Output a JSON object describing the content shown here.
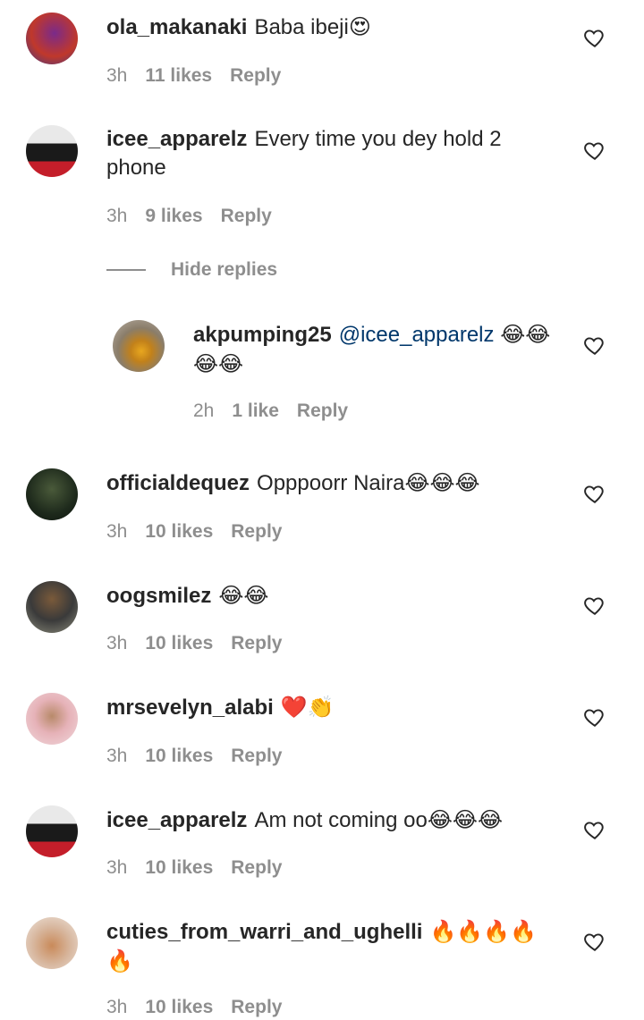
{
  "comments": [
    {
      "username": "ola_makanaki",
      "text": "Baba ibeji",
      "emoji": "😍",
      "time": "3h",
      "likes": "11 likes",
      "reply": "Reply"
    },
    {
      "username": "icee_apparelz",
      "text": "Every time you dey hold 2",
      "text2": "phone",
      "time": "3h",
      "likes": "9 likes",
      "reply": "Reply"
    },
    {
      "username": "officialdequez",
      "text": "Opppoorr Naira",
      "emoji": "😂😂😂",
      "time": "3h",
      "likes": "10 likes",
      "reply": "Reply"
    },
    {
      "username": "oogsmilez",
      "text": "",
      "emoji": "😂😂",
      "time": "3h",
      "likes": "10 likes",
      "reply": "Reply"
    },
    {
      "username": "mrsevelyn_alabi",
      "text": "",
      "emoji": "❤️👏",
      "time": "3h",
      "likes": "10 likes",
      "reply": "Reply"
    },
    {
      "username": "icee_apparelz",
      "text": "Am not coming oo",
      "emoji": "😂😂😂",
      "time": "3h",
      "likes": "10 likes",
      "reply": "Reply"
    },
    {
      "username": "cuties_from_warri_and_ughelli",
      "text": "",
      "emoji": "🔥🔥🔥🔥",
      "emoji2": "🔥",
      "time": "3h",
      "likes": "10 likes",
      "reply": "Reply"
    }
  ],
  "reply": {
    "username": "akpumping25",
    "mention": "@icee_apparelz",
    "emoji": "😂😂",
    "emoji2": "😂😂",
    "time": "2h",
    "likes": "1 like",
    "reply": "Reply"
  },
  "hide_replies": "Hide replies",
  "icons": {
    "like": "heart-outline-icon"
  },
  "colors": {
    "text": "#262626",
    "meta": "#8e8e8e",
    "mention": "#00376b"
  }
}
